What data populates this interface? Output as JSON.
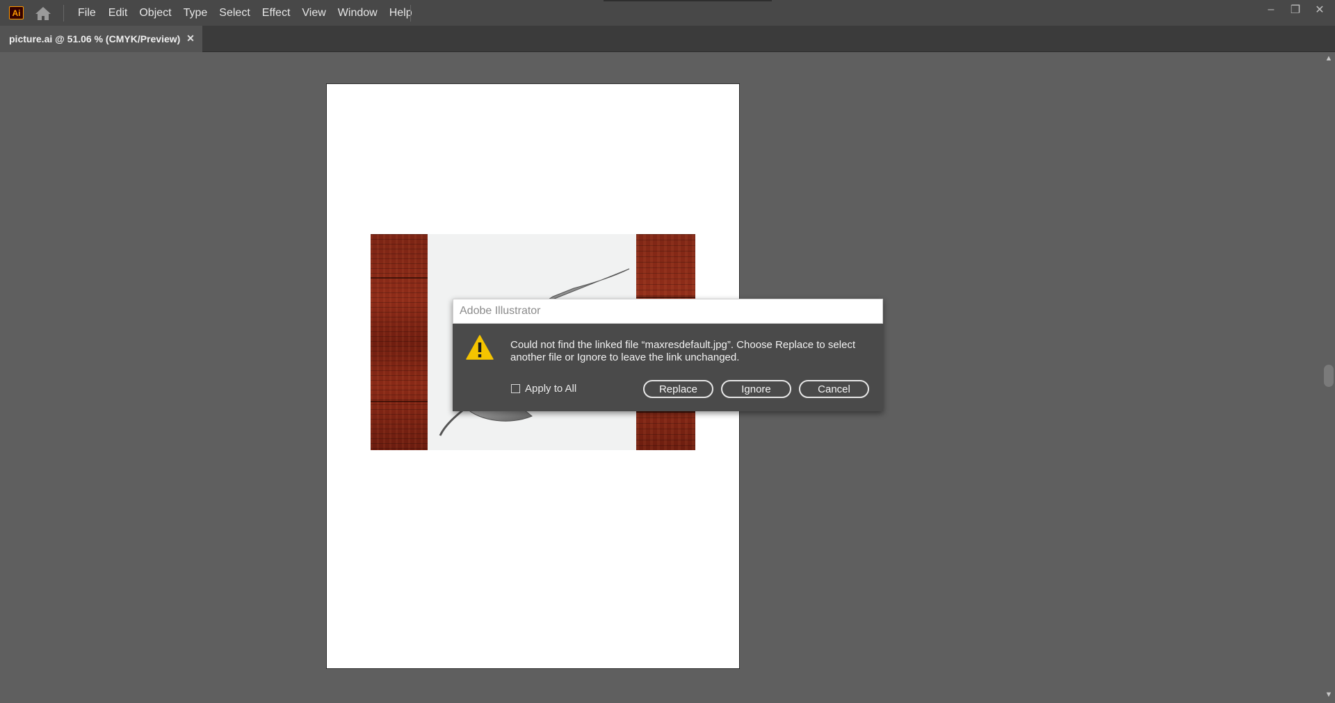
{
  "app": {
    "logo_text": "Ai",
    "brand_color": "#ff9a00"
  },
  "menu": {
    "items": [
      "File",
      "Edit",
      "Object",
      "Type",
      "Select",
      "Effect",
      "View",
      "Window",
      "Help"
    ]
  },
  "window_controls": {
    "minimize": "–",
    "restore": "❐",
    "close": "✕"
  },
  "document_tab": {
    "title": "picture.ai @ 51.06 % (CMYK/Preview)",
    "close": "✕"
  },
  "dialog": {
    "title": "Adobe Illustrator",
    "message": "Could not find the linked file “maxresdefault.jpg”. Choose Replace to select another file or Ignore to leave the link unchanged.",
    "apply_all_label": "Apply to All",
    "apply_all_checked": false,
    "replace_label": "Replace",
    "ignore_label": "Ignore",
    "cancel_label": "Cancel",
    "warning_color": "#f5c400"
  },
  "scrollbar": {
    "up_arrow": "▲",
    "down_arrow": "▼"
  },
  "icons": [
    "app-logo-icon",
    "home-icon",
    "minimize-icon",
    "restore-icon",
    "close-icon",
    "warning-icon",
    "leaf-image"
  ]
}
